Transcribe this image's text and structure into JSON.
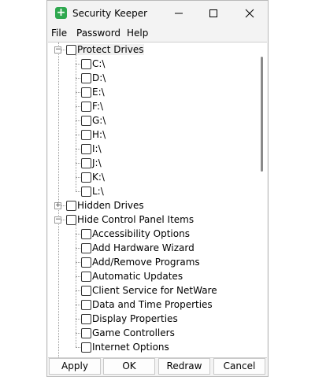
{
  "window": {
    "title": "Security Keeper",
    "icon_name": "plus-icon",
    "icon_color": "#2fa84f"
  },
  "menu": [
    "File",
    "Password",
    "Help"
  ],
  "tree": [
    {
      "label": "Protect Drives",
      "expander": "−",
      "children": [
        "C:\\",
        "D:\\",
        "E:\\",
        "F:\\",
        "G:\\",
        "H:\\",
        "I:\\",
        "J:\\",
        "K:\\",
        "L:\\"
      ]
    },
    {
      "label": "Hidden Drives",
      "expander": "+",
      "children": []
    },
    {
      "label": "Hide Control Panel Items",
      "expander": "−",
      "children": [
        "Accessibility Options",
        "Add Hardware Wizard",
        "Add/Remove Programs",
        "Automatic Updates",
        "Client Service for NetWare",
        "Data and Time Properties",
        "Display Properties",
        "Game Controllers",
        "Internet Options"
      ]
    }
  ],
  "buttons": [
    "Apply",
    "OK",
    "Redraw",
    "Cancel"
  ]
}
